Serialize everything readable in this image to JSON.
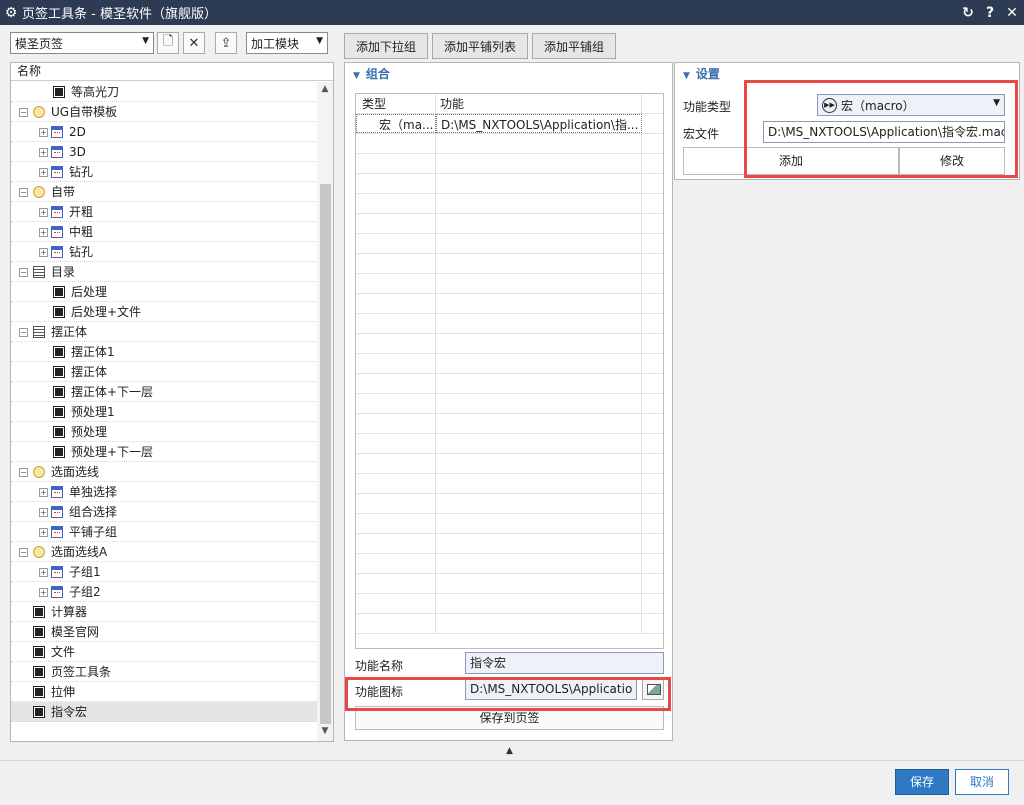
{
  "window": {
    "title": "页签工具条 - 模圣软件（旗舰版）",
    "controls": [
      "↻",
      "?",
      "✕"
    ]
  },
  "left_panel": {
    "tab_combo": "模圣页签",
    "module_combo": "加工模块",
    "tree_header": "名称",
    "tree": [
      {
        "label": "等高光刀",
        "icon": "black-square-icon",
        "depth": 2,
        "expander": ""
      },
      {
        "label": "UG自带模板",
        "icon": "group-icon",
        "depth": 0,
        "expander": "−"
      },
      {
        "label": "2D",
        "icon": "calendar-icon",
        "depth": 1,
        "expander": "+"
      },
      {
        "label": "3D",
        "icon": "calendar-icon",
        "depth": 1,
        "expander": "+"
      },
      {
        "label": "钻孔",
        "icon": "calendar-icon",
        "depth": 1,
        "expander": "+"
      },
      {
        "label": "自带",
        "icon": "group-icon",
        "depth": 0,
        "expander": "−"
      },
      {
        "label": "开粗",
        "icon": "calendar-icon",
        "depth": 1,
        "expander": "+"
      },
      {
        "label": "中粗",
        "icon": "calendar-icon",
        "depth": 1,
        "expander": "+"
      },
      {
        "label": "钻孔",
        "icon": "calendar-icon",
        "depth": 1,
        "expander": "+"
      },
      {
        "label": "目录",
        "icon": "list-icon",
        "depth": 0,
        "expander": "−"
      },
      {
        "label": "后处理",
        "icon": "black-square-icon",
        "depth": 2,
        "expander": ""
      },
      {
        "label": "后处理+文件",
        "icon": "black-square-icon",
        "depth": 2,
        "expander": ""
      },
      {
        "label": "摆正体",
        "icon": "list-icon",
        "depth": 0,
        "expander": "−"
      },
      {
        "label": "摆正体1",
        "icon": "black-square-icon",
        "depth": 2,
        "expander": ""
      },
      {
        "label": "摆正体",
        "icon": "black-square-icon",
        "depth": 2,
        "expander": ""
      },
      {
        "label": "摆正体+下一层",
        "icon": "black-square-icon",
        "depth": 2,
        "expander": ""
      },
      {
        "label": "预处理1",
        "icon": "black-square-icon",
        "depth": 2,
        "expander": ""
      },
      {
        "label": "预处理",
        "icon": "black-square-icon",
        "depth": 2,
        "expander": ""
      },
      {
        "label": "预处理+下一层",
        "icon": "black-square-icon",
        "depth": 2,
        "expander": ""
      },
      {
        "label": "选面选线",
        "icon": "group-icon",
        "depth": 0,
        "expander": "−"
      },
      {
        "label": "单独选择",
        "icon": "calendar-icon",
        "depth": 1,
        "expander": "+"
      },
      {
        "label": "组合选择",
        "icon": "calendar-icon",
        "depth": 1,
        "expander": "+"
      },
      {
        "label": "平铺子组",
        "icon": "calendar-icon",
        "depth": 1,
        "expander": "+"
      },
      {
        "label": "选面选线A",
        "icon": "group-icon",
        "depth": 0,
        "expander": "−"
      },
      {
        "label": "子组1",
        "icon": "calendar-icon",
        "depth": 1,
        "expander": "+"
      },
      {
        "label": "子组2",
        "icon": "calendar-icon",
        "depth": 1,
        "expander": "+"
      },
      {
        "label": "计算器",
        "icon": "black-square-icon",
        "depth": 0,
        "expander": ""
      },
      {
        "label": "模圣官网",
        "icon": "black-square-icon",
        "depth": 0,
        "expander": ""
      },
      {
        "label": "文件",
        "icon": "black-square-icon",
        "depth": 0,
        "expander": ""
      },
      {
        "label": "页签工具条",
        "icon": "black-square-icon",
        "depth": 0,
        "expander": ""
      },
      {
        "label": "拉伸",
        "icon": "black-square-icon",
        "depth": 0,
        "expander": ""
      },
      {
        "label": "指令宏",
        "icon": "black-square-icon",
        "depth": 0,
        "expander": "",
        "selected": true
      }
    ]
  },
  "toolbar": {
    "add_dropdown_group": "添加下拉组",
    "add_tile_list": "添加平铺列表",
    "add_tile_group": "添加平铺组"
  },
  "group_section": {
    "title": "组合",
    "columns": [
      "类型",
      "功能"
    ],
    "rows": [
      {
        "type": "宏（ma...",
        "function": "D:\\MS_NXTOOLS\\Application\\指..."
      }
    ],
    "function_name_label": "功能名称",
    "function_name_value": "指令宏",
    "function_icon_label": "功能图标",
    "function_icon_value": "D:\\MS_NXTOOLS\\Applicatio",
    "save_to_tab": "保存到页签"
  },
  "settings_section": {
    "title": "设置",
    "function_type_label": "功能类型",
    "function_type_value": "宏（macro）",
    "macro_file_label": "宏文件",
    "macro_file_value": "D:\\MS_NXTOOLS\\Application\\指令宏.mac",
    "add_button": "添加",
    "modify_button": "修改"
  },
  "footer": {
    "save": "保存",
    "cancel": "取消"
  },
  "colors": {
    "titlebar": "#2e3b55",
    "accent": "#2f78c4",
    "highlight_box": "#e84848",
    "section_title": "#3b6fb0"
  }
}
